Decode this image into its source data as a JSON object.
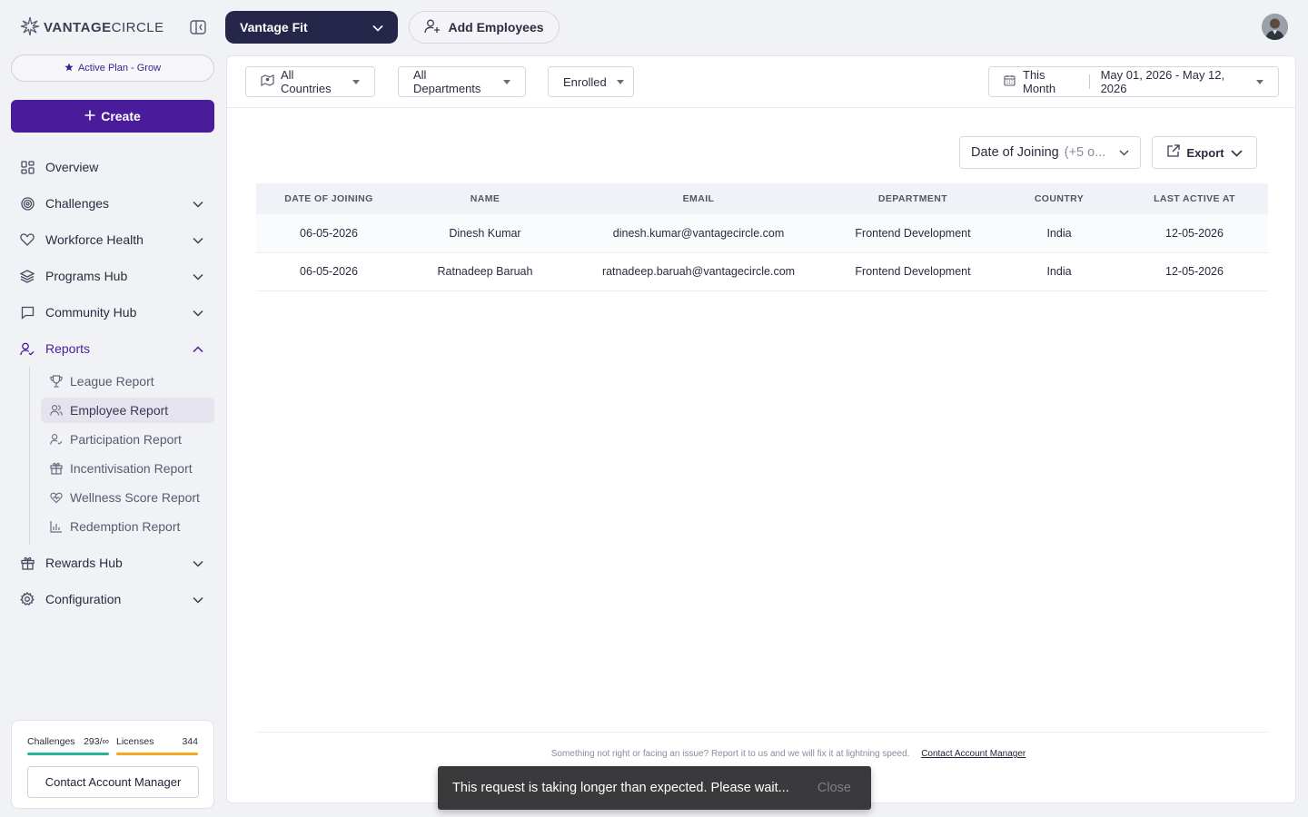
{
  "brand": {
    "logo_text_bold": "VANTAGE",
    "logo_text_light": "CIRCLE"
  },
  "sidebar": {
    "plan": "Active Plan - Grow",
    "create_label": "Create",
    "items": [
      {
        "label": "Overview",
        "icon": "grid-icon"
      },
      {
        "label": "Challenges",
        "icon": "target-icon"
      },
      {
        "label": "Workforce Health",
        "icon": "heart-icon"
      },
      {
        "label": "Programs Hub",
        "icon": "layers-icon"
      },
      {
        "label": "Community Hub",
        "icon": "chat-icon"
      },
      {
        "label": "Reports",
        "icon": "user-check-icon"
      },
      {
        "label": "Rewards Hub",
        "icon": "gift-icon"
      },
      {
        "label": "Configuration",
        "icon": "gear-icon"
      }
    ],
    "reports_sub": [
      {
        "label": "League Report",
        "icon": "trophy-icon"
      },
      {
        "label": "Employee Report",
        "icon": "users-icon"
      },
      {
        "label": "Participation Report",
        "icon": "user-check-icon"
      },
      {
        "label": "Incentivisation Report",
        "icon": "gift-icon"
      },
      {
        "label": "Wellness Score Report",
        "icon": "heart-pulse-icon"
      },
      {
        "label": "Redemption Report",
        "icon": "bar-chart-icon"
      }
    ],
    "usage": {
      "challenges_label": "Challenges",
      "challenges_value": "293/∞",
      "challenges_color": "#2bb39a",
      "licenses_label": "Licenses",
      "licenses_value": "344",
      "licenses_color": "#f5a623"
    },
    "contact_label": "Contact Account Manager"
  },
  "topbar": {
    "app_name": "Vantage Fit",
    "add_employees": "Add Employees"
  },
  "filters": {
    "countries": "All Countries",
    "departments": "All Departments",
    "status": "Enrolled",
    "period": "This Month",
    "range": "May 01, 2026 - May 12, 2026"
  },
  "table_controls": {
    "column_select": "Date of Joining",
    "column_more": "(+5 o...",
    "export": "Export"
  },
  "table": {
    "headers": [
      "DATE OF JOINING",
      "NAME",
      "EMAIL",
      "DEPARTMENT",
      "COUNTRY",
      "LAST ACTIVE AT"
    ],
    "rows": [
      [
        "06-05-2026",
        "Dinesh Kumar",
        "dinesh.kumar@vantagecircle.com",
        "Frontend Development",
        "India",
        "12-05-2026"
      ],
      [
        "06-05-2026",
        "Ratnadeep Baruah",
        "ratnadeep.baruah@vantagecircle.com",
        "Frontend Development",
        "India",
        "12-05-2026"
      ]
    ]
  },
  "footer": {
    "note": "Something not right or facing an issue? Report it to us and we will fix it at lightning speed.",
    "link": "Contact Account Manager"
  },
  "toast": {
    "message": "This request is taking longer than expected. Please wait...",
    "close": "Close"
  },
  "colors": {
    "accent": "#4a1b9a",
    "dark": "#26264a"
  }
}
